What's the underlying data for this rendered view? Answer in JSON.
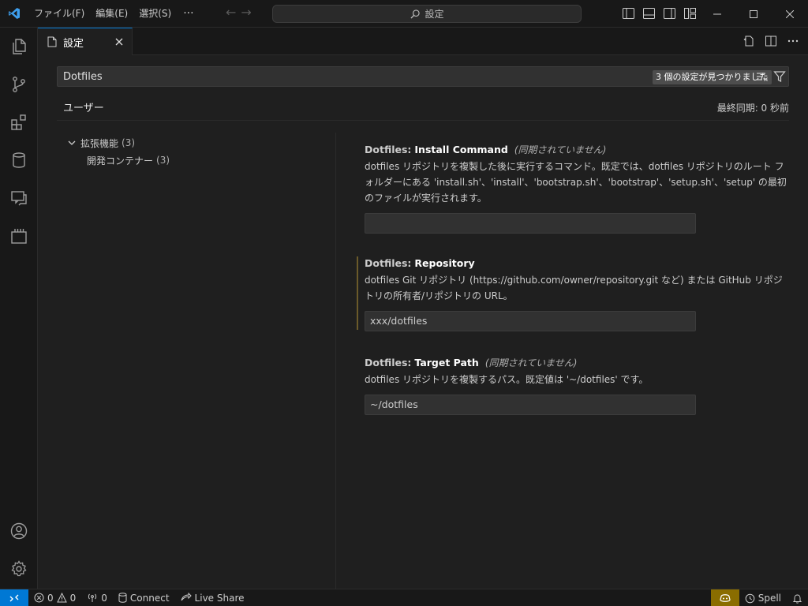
{
  "titlebar": {
    "menus": [
      "ファイル(F)",
      "編集(E)",
      "選択(S)"
    ],
    "more": "···",
    "command_center": "設定"
  },
  "tab": {
    "label": "設定",
    "close": "×"
  },
  "settings": {
    "search_value": "Dotfiles",
    "result_badge": "3 個の設定が見つかりました",
    "scope_tab": "ユーザー",
    "last_sync": "最終同期: 0 秒前",
    "toc": {
      "group_label": "拡張機能",
      "group_count": "(3)",
      "child_label": "開発コンテナー",
      "child_count": "(3)"
    },
    "items": [
      {
        "category": "Dotfiles:",
        "name": "Install Command",
        "note": "(同期されていません)",
        "description": "dotfiles リポジトリを複製した後に実行するコマンド。既定では、dotfiles リポジトリのルート フォルダーにある 'install.sh'、'install'、'bootstrap.sh'、'bootstrap'、'setup.sh'、'setup' の最初のファイルが実行されます。",
        "value": ""
      },
      {
        "category": "Dotfiles:",
        "name": "Repository",
        "note": "",
        "description": "dotfiles Git リポジトリ (https://github.com/owner/repository.git など) または GitHub リポジトリの所有者/リポジトリの URL。",
        "value": "xxx/dotfiles"
      },
      {
        "category": "Dotfiles:",
        "name": "Target Path",
        "note": "(同期されていません)",
        "description": "dotfiles リポジトリを複製するパス。既定値は '~/dotfiles' です。",
        "value": "~/dotfiles"
      }
    ]
  },
  "statusbar": {
    "errors": "0",
    "warnings": "0",
    "ports": "0",
    "connect": "Connect",
    "live_share": "Live Share",
    "spell": "Spell"
  },
  "colors": {
    "accent": "#0078d4",
    "background": "#1f1f1f",
    "sidebar": "#181818",
    "modified": "#6b5a2a",
    "copilot": "#8a6d00"
  }
}
